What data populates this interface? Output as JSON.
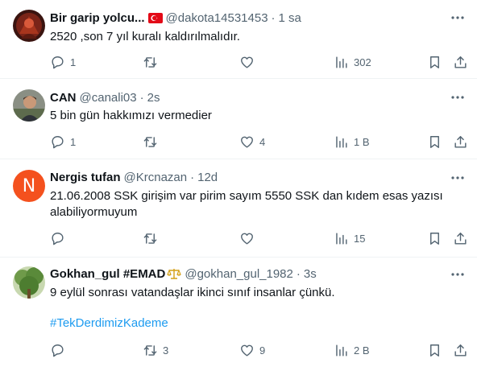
{
  "tweets": [
    {
      "name": "Bir garip yolcu...",
      "handle": "@dakota14531453",
      "sep": "·",
      "time": "1 sa",
      "text": "2520 ,son 7 yıl kuralı kaldırılmalıdır.",
      "replies": "1",
      "retweets": "",
      "likes": "",
      "views": "302",
      "badge": "turkey-flag-icon"
    },
    {
      "name": "CAN",
      "handle": "@canali03",
      "sep": "·",
      "time": "2s",
      "text": "5 bin gün hakkımızı vermedier",
      "replies": "1",
      "retweets": "",
      "likes": "4",
      "views": "1 B"
    },
    {
      "name": "Nergis tufan",
      "handle": "@Krcnazan",
      "sep": "·",
      "time": "12d",
      "text": "21.06.2008 SSK girişim var pirim sayım 5550  SSK dan kıdem esas yazısı alabiliyormuyum",
      "replies": "",
      "retweets": "",
      "likes": "",
      "views": "15",
      "avatar_letter": "N"
    },
    {
      "name": "Gokhan_gul #EMAD",
      "handle": "@gokhan_gul_1982",
      "sep": "·",
      "time": "3s",
      "text": "9 eylül sonrası vatandaşlar ikinci sınıf insanlar çünkü.",
      "hashtag": "#TekDerdimizKademe",
      "replies": "",
      "retweets": "3",
      "likes": "9",
      "views": "2 B",
      "badge": "balance-scale-icon"
    }
  ],
  "colors": {
    "text": "#0f1419",
    "secondary": "#536471",
    "link": "#1d9bf0",
    "divider": "#eff3f4",
    "flag_red": "#e30a17",
    "avatar_orange": "#f4511e",
    "scale_gold": "#d4a017"
  }
}
